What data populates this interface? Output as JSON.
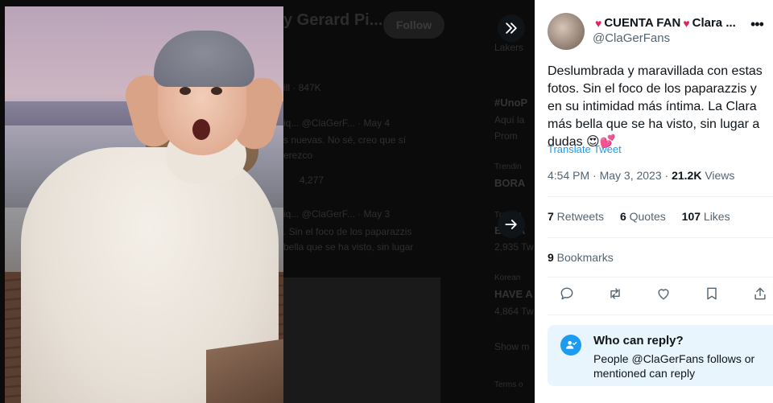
{
  "background": {
    "profile_title": "y Gerard Pi...",
    "follow_label": "Follow",
    "tweet_lines": [
      "ill · 847K",
      "iq... @ClaGerF... · May 4",
      "s nuevas. No sé, creo que sí",
      "erezco",
      "4,277",
      "iq... @ClaGerF... · May 3",
      ". Sin el foco de los paparazzis",
      "bella que se ha visto, sin lugar"
    ],
    "side_lines": [
      "Lakers",
      "#UnoP",
      "Aquí la",
      "Prom",
      "Trendin",
      "BORA",
      "Trendin",
      "BORA",
      "2,935 Tw",
      "Korean",
      "HAVE A",
      "4,864 Tw",
      "Show m",
      "Terms o"
    ]
  },
  "tweet": {
    "author_name_left_heart": "♥",
    "author_name": "CUENTA FAN",
    "author_name_right_heart": "♥",
    "author_name_suffix": "Clara ...",
    "author_handle": "@ClaGerFans",
    "more_label": "•••",
    "text": "Deslumbrada y maravillada con estas fotos. Sin el foco de los paparazzis y en su intimidad más íntima. La Clara más bella que se ha visto, sin lugar a dudas 😍💕",
    "translate_label": "Translate Tweet",
    "time": "4:54 PM · May 3, 2023 · ",
    "views_count": "21.2K",
    "views_label": " Views",
    "retweets_count": "7",
    "retweets_label": " Retweets",
    "quotes_count": "6",
    "quotes_label": " Quotes",
    "likes_count": "107",
    "likes_label": " Likes",
    "bookmarks_count": "9",
    "bookmarks_label": " Bookmarks"
  },
  "reply": {
    "title": "Who can reply?",
    "description": "People @ClaGerFans follows or mentioned can reply"
  },
  "colors": {
    "accent": "#1d9bf0",
    "heart": "#e0245e",
    "text_primary": "#0f1419",
    "text_secondary": "#536471"
  },
  "icons": [
    "collapse-icon",
    "arrow-right-icon",
    "reply-icon",
    "retweet-icon",
    "like-icon",
    "bookmark-icon",
    "share-icon",
    "person-check-icon"
  ]
}
